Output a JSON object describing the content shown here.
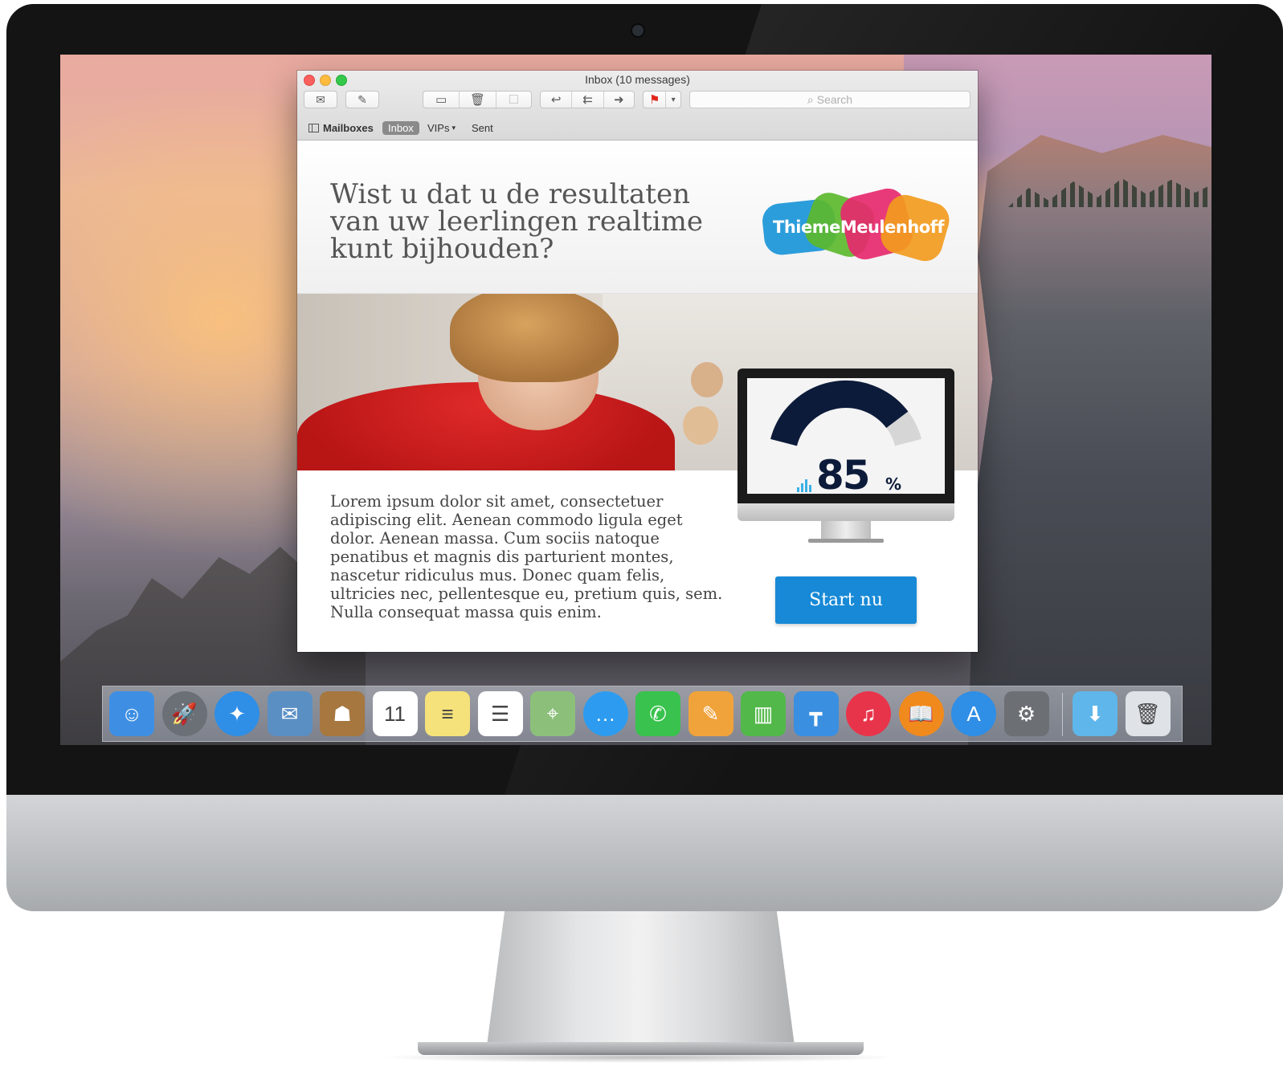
{
  "window": {
    "title": "Inbox (10 messages)"
  },
  "toolbar": {
    "search_placeholder": "Search",
    "icons": [
      "envelope-icon",
      "compose-icon",
      "archive-icon",
      "trash-icon",
      "junk-icon",
      "reply-icon",
      "reply-all-icon",
      "forward-icon",
      "flag-icon",
      "chevron-down-icon"
    ]
  },
  "favorites": {
    "mailboxes": "Mailboxes",
    "inbox": "Inbox",
    "vips": "VIPs",
    "sent": "Sent"
  },
  "email": {
    "headline": "Wist u dat u de resultaten van uw leerlingen realtime kunt bijhouden?",
    "logo_text": "ThiemeMeulenhoff",
    "body": "Lorem ipsum dolor sit amet, consectetuer adipiscing elit. Aenean commodo ligula eget dolor. Aenean massa. Cum sociis natoque penatibus et magnis dis parturient montes, nascetur ridiculus mus. Donec quam felis, ultricies nec, pellentesque eu, pretium quis, sem. Nulla consequat massa quis enim.",
    "gauge": {
      "value": "85",
      "unit": "%",
      "fraction": 0.85
    },
    "cta_label": "Start nu"
  },
  "dock": {
    "items": [
      {
        "name": "finder-icon",
        "glyph": "☺",
        "bg": "#3e8fe3"
      },
      {
        "name": "launchpad-icon",
        "glyph": "🚀",
        "bg": "#6b6f76"
      },
      {
        "name": "safari-icon",
        "glyph": "✦",
        "bg": "#2f8ee6"
      },
      {
        "name": "mail-icon",
        "glyph": "✉",
        "bg": "#5a8fc4"
      },
      {
        "name": "contacts-icon",
        "glyph": "☗",
        "bg": "#a6773f"
      },
      {
        "name": "calendar-icon",
        "glyph": "11",
        "bg": "#ffffff"
      },
      {
        "name": "notes-icon",
        "glyph": "≡",
        "bg": "#f6e27a"
      },
      {
        "name": "reminders-icon",
        "glyph": "☰",
        "bg": "#ffffff"
      },
      {
        "name": "maps-icon",
        "glyph": "⌖",
        "bg": "#8cc07a"
      },
      {
        "name": "messages-icon",
        "glyph": "…",
        "bg": "#2d9cf0"
      },
      {
        "name": "facetime-icon",
        "glyph": "✆",
        "bg": "#39c24d"
      },
      {
        "name": "pages-icon",
        "glyph": "✎",
        "bg": "#f0a33b"
      },
      {
        "name": "numbers-icon",
        "glyph": "▥",
        "bg": "#53b84a"
      },
      {
        "name": "keynote-icon",
        "glyph": "┳",
        "bg": "#3a8fe0"
      },
      {
        "name": "itunes-icon",
        "glyph": "♫",
        "bg": "#e8344b"
      },
      {
        "name": "ibooks-icon",
        "glyph": "📖",
        "bg": "#f08a1d"
      },
      {
        "name": "app-store-icon",
        "glyph": "A",
        "bg": "#2f8ee6"
      },
      {
        "name": "system-preferences-icon",
        "glyph": "⚙",
        "bg": "#6c6f74"
      },
      {
        "name": "downloads-folder-icon",
        "glyph": "⬇",
        "bg": "#5fb6ea"
      },
      {
        "name": "trash-icon",
        "glyph": "🗑",
        "bg": "#dfe3e8"
      }
    ]
  },
  "colors": {
    "accent": "#1789d6",
    "gauge_dark": "#0d1b3a",
    "gauge_light": "#d6d6d6"
  }
}
